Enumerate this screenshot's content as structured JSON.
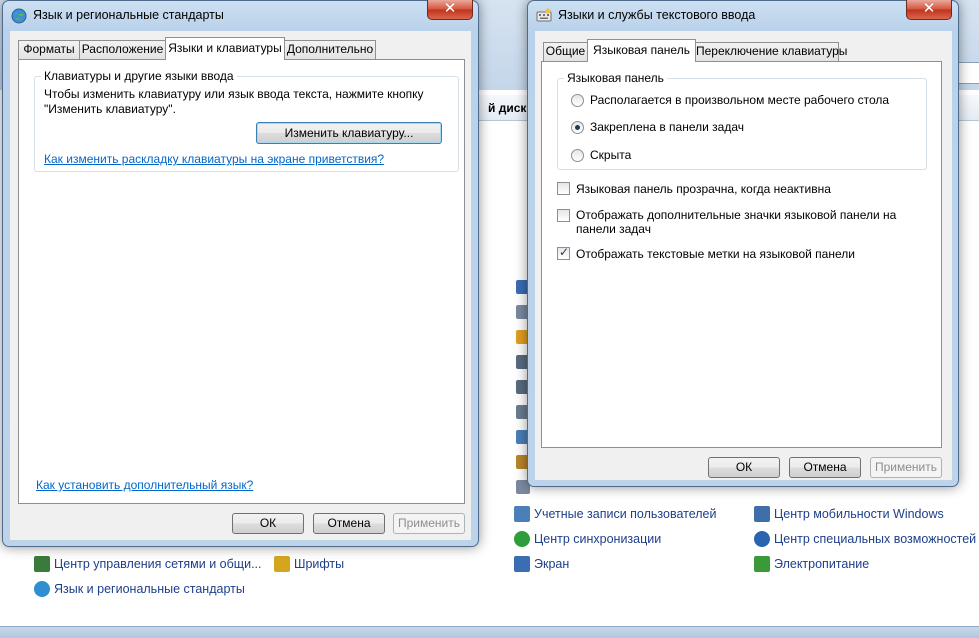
{
  "background": {
    "address_text": "й диск",
    "items": [
      {
        "label": "Центр управления сетями и общи...",
        "color": "#3a7a3a"
      },
      {
        "label": "Язык и региональные стандарты",
        "color": "#2f8fd0"
      },
      {
        "label": "Шрифты",
        "color": "#d6a520"
      },
      {
        "label": "Учетные записи пользователей",
        "color": "#4a7fb8"
      },
      {
        "label": "Центр синхронизации",
        "color": "#2e9e3a"
      },
      {
        "label": "Экран",
        "color": "#3b6db3"
      },
      {
        "label": "Центр мобильности Windows",
        "color": "#3f6fa8"
      },
      {
        "label": "Центр специальных возможностей",
        "color": "#2a64b0"
      },
      {
        "label": "Электропитание",
        "color": "#3a9a3a"
      }
    ]
  },
  "regional_window": {
    "title": "Язык и региональные стандарты",
    "tabs": [
      "Форматы",
      "Расположение",
      "Языки и клавиатуры",
      "Дополнительно"
    ],
    "active_tab": "Языки и клавиатуры",
    "group_title": "Клавиатуры и другие языки ввода",
    "description_line1": "Чтобы изменить клавиатуру или язык ввода текста, нажмите кнопку",
    "description_line2": "\"Изменить клавиатуру\".",
    "change_keyboard_button": "Изменить клавиатуру...",
    "welcome_link": "Как изменить раскладку клавиатуры на экране приветствия?",
    "install_language_link": "Как установить дополнительный язык?",
    "ok": "ОК",
    "cancel": "Отмена",
    "apply": "Применить"
  },
  "text_services_window": {
    "title": "Языки и службы текстового ввода",
    "tabs": [
      "Общие",
      "Языковая панель",
      "Переключение клавиатуры"
    ],
    "active_tab": "Языковая панель",
    "group_title": "Языковая панель",
    "radio_options": [
      {
        "label": "Располагается в произвольном месте рабочего стола",
        "checked": false
      },
      {
        "label": "Закреплена в панели задач",
        "checked": true
      },
      {
        "label": "Скрыта",
        "checked": false
      }
    ],
    "checkbox_transparent": {
      "label": "Языковая панель прозрачна, когда неактивна",
      "checked": false
    },
    "checkbox_extra_icons": {
      "line1": "Отображать дополнительные значки языковой панели на",
      "line2": "панели задач",
      "checked": false
    },
    "checkbox_text_labels": {
      "label": "Отображать текстовые метки на языковой панели",
      "checked": true
    },
    "ok": "ОК",
    "cancel": "Отмена",
    "apply": "Применить"
  }
}
